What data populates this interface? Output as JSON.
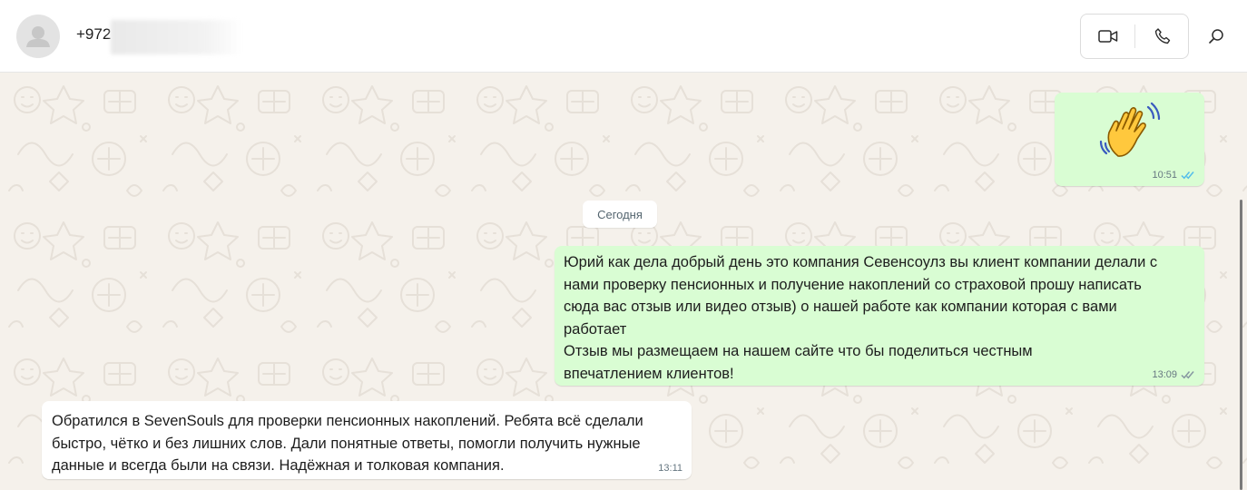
{
  "header": {
    "contact_phone": "+972",
    "icons": {
      "avatar": "default-person-avatar",
      "video": "video-call-icon",
      "voice": "voice-call-icon",
      "search": "search-icon"
    }
  },
  "chat": {
    "date_separator": "Сегодня",
    "messages": [
      {
        "direction": "outgoing",
        "emoji": "👋",
        "time": "10:51",
        "status": "read"
      },
      {
        "direction": "outgoing",
        "lines": [
          "Юрий как дела добрый день это компания Севенсоулз вы клиент компании делали с",
          "нами проверку пенсионных и получение накоплений со страховой прошу написать",
          "сюда вас отзыв или видео отзыв) о нашей работе как компании которая с вами",
          "работает",
          "Отзыв мы размещаем на нашем сайте что бы поделиться честным",
          "впечатлением клиентов!"
        ],
        "time": "13:09",
        "status": "delivered"
      },
      {
        "direction": "incoming",
        "lines": [
          "Обратился в SevenSouls для проверки пенсионных накоплений. Ребята всё сделали",
          "быстро, чётко и без лишних слов. Дали понятные ответы, помогли получить нужные",
          "данные и всегда были на связи. Надёжная и толковая компания."
        ],
        "time": "13:11"
      }
    ]
  },
  "colors": {
    "outgoing_bubble": "#d9fdd3",
    "incoming_bubble": "#ffffff",
    "read_ticks": "#53bdeb",
    "delivered_ticks": "#8696a0",
    "wallpaper": "#f5f1eb"
  }
}
